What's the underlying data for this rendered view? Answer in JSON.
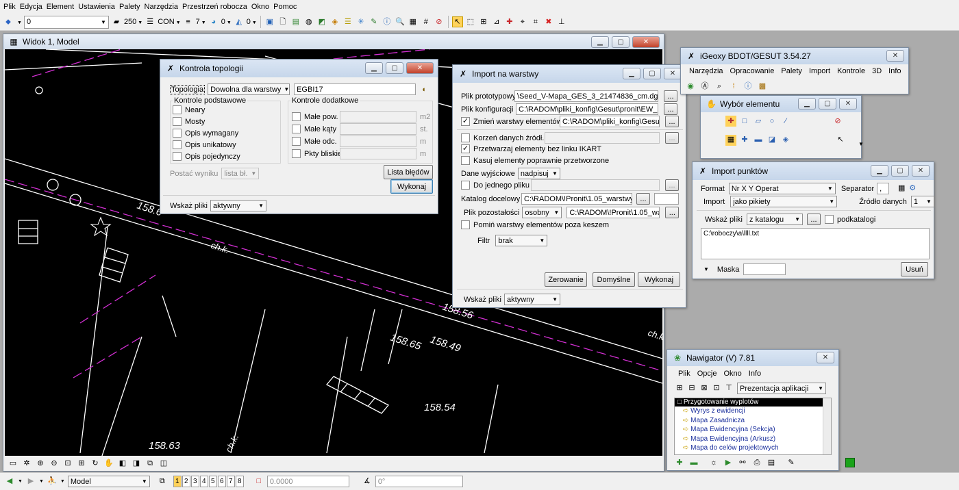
{
  "menu": [
    "Plik",
    "Edycja",
    "Element",
    "Ustawienia",
    "Palety",
    "Narzędzia",
    "Przestrzeń robocza",
    "Okno",
    "Pomoc"
  ],
  "toolbar": {
    "level_value": "0",
    "weight_value": "250",
    "style_value": "CON",
    "weight2_value": "7",
    "color_value": "0",
    "trans_value": "0"
  },
  "view_window": {
    "title": "Widok 1, Model",
    "labels": [
      {
        "text": "158.6"
      },
      {
        "text": "ch.k."
      },
      {
        "text": "158.56"
      },
      {
        "text": "158.65"
      },
      {
        "text": "158.49"
      },
      {
        "text": "158.54"
      },
      {
        "text": "158.63"
      },
      {
        "text": "ch.k."
      },
      {
        "text": "ch.k"
      }
    ]
  },
  "topology": {
    "title": "Kontrola topologii",
    "topology_label": "Topologia",
    "topology_value": "Dowolna dla warstwy",
    "topology_code": "EGBI17",
    "basic_title": "Kontrole podstawowe",
    "basic_items": [
      "Neary",
      "Mosty",
      "Opis wymagany",
      "Opis unikatowy",
      "Opis pojedynczy"
    ],
    "extra_title": "Kontrole dodatkowe",
    "extra_items": [
      {
        "label": "Małe pow.",
        "unit": "m2"
      },
      {
        "label": "Małe kąty",
        "unit": "st."
      },
      {
        "label": "Małe odc.",
        "unit": "m"
      },
      {
        "label": "Pkty bliskie",
        "unit": "m"
      }
    ],
    "result_label": "Postać wyniku",
    "result_value": "lista bł.",
    "errors_button": "Lista błędów",
    "run_button": "Wykonaj",
    "files_label": "Wskaż pliki",
    "files_value": "aktywny"
  },
  "import_layers": {
    "title": "Import na warstwy",
    "proto_label": "Plik prototypowy",
    "proto_value": "\\Seed_V-Mapa_GES_3_21474836_cm.dgn",
    "config_label": "Plik konfiguracji",
    "config_value": "C:\\RADOM\\pliki_konfig\\Gesut\\pronit\\EW_ko",
    "change_label": "Zmień warstwy elementów",
    "change_value": "C:\\RADOM\\pliki_konfig\\Gesut\\",
    "root_label": "Korzeń danych źródł.",
    "process_label": "Przetwarzaj elementy bez linku IKART",
    "delete_label": "Kasuj elementy poprawnie przetworzone",
    "output_label": "Dane wyjściowe",
    "output_value": "nadpisuj",
    "single_label": "Do jednego pliku",
    "target_label": "Katalog docelowy",
    "target_value": "C:\\RADOM\\!Pronit\\1.05_warstwy_",
    "rest_label": "Plik pozostałości",
    "rest_mode": "osobny",
    "rest_value": "C:\\RADOM\\!Pronit\\1.05_war",
    "skip_label": "Pomiń warstwy elementów poza keszem",
    "filter_label": "Filtr",
    "filter_value": "brak",
    "reset_button": "Zerowanie",
    "defaults_button": "Domyślne",
    "run_button": "Wykonaj",
    "files_label": "Wskaż pliki",
    "files_value": "aktywny",
    "browse": "..."
  },
  "igeoxy": {
    "title": "iGeoxy BDOT/GESUT 3.54.27",
    "menu": [
      "Narzędzia",
      "Opracowanie",
      "Palety",
      "Import",
      "Kontrole",
      "3D",
      "Info"
    ]
  },
  "select_element": {
    "title": "Wybór elementu"
  },
  "import_points": {
    "title": "Import punktów",
    "format_label": "Format",
    "format_value": "Nr  X  Y  Operat",
    "sep_label": "Separator",
    "sep_value": ",",
    "import_label": "Import",
    "import_value": "jako pikiety",
    "source_label": "Źródło danych",
    "source_value": "1",
    "files_label": "Wskaż pliki",
    "files_value": "z katalogu",
    "subdirs_label": "podkatalogi",
    "path": "C:\\roboczy\\a\\llll.txt",
    "mask_label": "Maska",
    "remove_button": "Usuń"
  },
  "navigator": {
    "title": "Nawigator (V) 7.81",
    "menu": [
      "Plik",
      "Opcje",
      "Okno",
      "Info"
    ],
    "mode_value": "Prezentacja aplikacji",
    "tree_header": "Przygotowanie wyplotów",
    "items": [
      "Wyrys z ewidencji",
      "Mapa Zasadnicza",
      "Mapa Ewidencyjna (Sekcja)",
      "Mapa Ewidencyjna (Arkusz)",
      "Mapa do celów projektowych"
    ]
  },
  "statusbar": {
    "model_value": "Model",
    "views": [
      "1",
      "2",
      "3",
      "4",
      "5",
      "6",
      "7",
      "8"
    ],
    "coord_value": "0.0000",
    "angle_value": "0°"
  },
  "colors": {
    "accent": "#ffd25a",
    "title_bar": "#c6d6ea",
    "canvas": "#000000"
  }
}
